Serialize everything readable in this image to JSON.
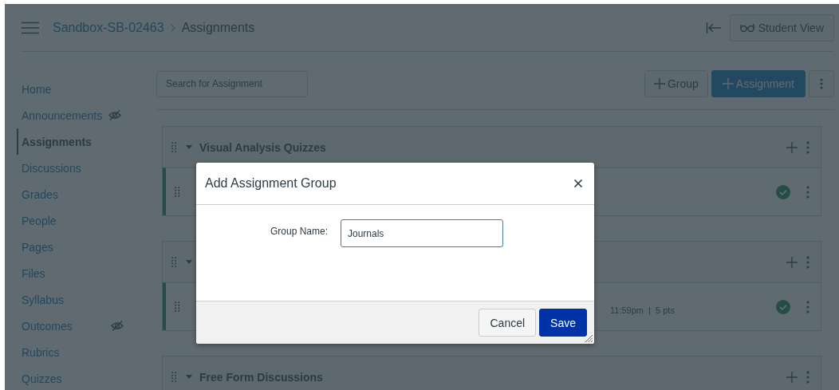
{
  "header": {
    "breadcrumbs": [
      "Sandbox-SB-02463",
      "Assignments"
    ],
    "student_view": "Student View"
  },
  "sidebar": {
    "items": [
      {
        "label": "Home",
        "selected": false,
        "hidden": false
      },
      {
        "label": "Announcements",
        "selected": false,
        "hidden": true
      },
      {
        "label": "Assignments",
        "selected": true,
        "hidden": false
      },
      {
        "label": "Discussions",
        "selected": false,
        "hidden": false
      },
      {
        "label": "Grades",
        "selected": false,
        "hidden": false
      },
      {
        "label": "People",
        "selected": false,
        "hidden": false
      },
      {
        "label": "Pages",
        "selected": false,
        "hidden": false
      },
      {
        "label": "Files",
        "selected": false,
        "hidden": false
      },
      {
        "label": "Syllabus",
        "selected": false,
        "hidden": false
      },
      {
        "label": "Outcomes",
        "selected": false,
        "hidden": true
      },
      {
        "label": "Rubrics",
        "selected": false,
        "hidden": false
      },
      {
        "label": "Quizzes",
        "selected": false,
        "hidden": false
      }
    ]
  },
  "toolbar": {
    "search": {
      "placeholder": "Search for Assignment"
    },
    "buttons": [
      {
        "label": "Group",
        "kind": "secondary"
      },
      {
        "label": "Assignment",
        "kind": "primary"
      }
    ]
  },
  "groups": [
    {
      "title": "Visual Analysis Quizzes",
      "rows": [
        {
          "published": true
        }
      ]
    },
    {
      "rows": [
        {
          "published": true,
          "meta": "11:59pm  |  5 pts"
        }
      ]
    },
    {
      "title": "Free Form Discussions"
    }
  ],
  "dialog": {
    "title": "Add Assignment Group",
    "fields": [
      {
        "label": "Group Name:",
        "value": "Journals"
      }
    ],
    "buttons": [
      {
        "label": "Cancel",
        "kind": "secondary"
      },
      {
        "label": "Save",
        "kind": "primary"
      }
    ]
  }
}
